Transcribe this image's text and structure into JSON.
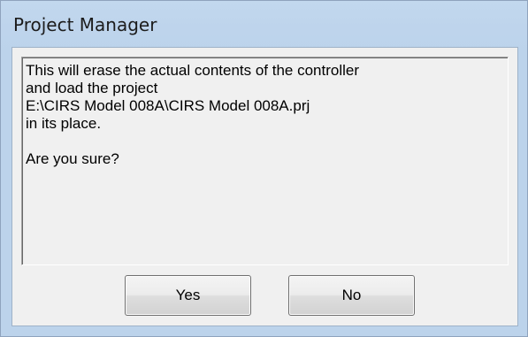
{
  "window": {
    "title": "Project Manager"
  },
  "message": {
    "text": "This will erase the actual contents of the controller\nand load the project\nE:\\CIRS Model 008A\\CIRS Model 008A.prj\nin its place.\n\nAre you sure?"
  },
  "buttons": {
    "yes_label": "Yes",
    "no_label": "No"
  },
  "colors": {
    "frame": "#bcd3eb",
    "client_background": "#f0f0f0",
    "button_border": "#707070"
  }
}
